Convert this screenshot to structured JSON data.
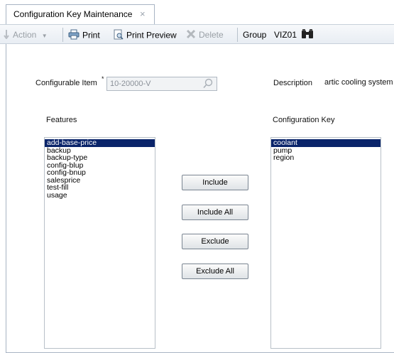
{
  "tab": {
    "title": "Configuration Key Maintenance",
    "close_icon": "×"
  },
  "toolbar": {
    "action_label": "Action",
    "print_label": "Print",
    "print_preview_label": "Print Preview",
    "delete_label": "Delete",
    "group_label": "Group",
    "group_value": "VIZ01"
  },
  "form": {
    "configurable_item_label": "Configurable Item",
    "required_marker": "*",
    "configurable_item_value": "10-20000-V",
    "description_label": "Description",
    "description_value": "artic cooling system",
    "features_label": "Features",
    "config_key_label": "Configuration Key"
  },
  "features": [
    {
      "label": "add-base-price",
      "selected": true
    },
    {
      "label": "backup"
    },
    {
      "label": "backup-type"
    },
    {
      "label": "config-blup"
    },
    {
      "label": "config-bnup"
    },
    {
      "label": "salesprice"
    },
    {
      "label": "test-fill"
    },
    {
      "label": "usage"
    }
  ],
  "config_keys": [
    {
      "label": "coolant",
      "selected": true
    },
    {
      "label": "pump"
    },
    {
      "label": "region"
    }
  ],
  "buttons": {
    "include": "Include",
    "include_all": "Include All",
    "exclude": "Exclude",
    "exclude_all": "Exclude All"
  },
  "colors": {
    "selection": "#0a246a",
    "border": "#a8b4c4"
  }
}
